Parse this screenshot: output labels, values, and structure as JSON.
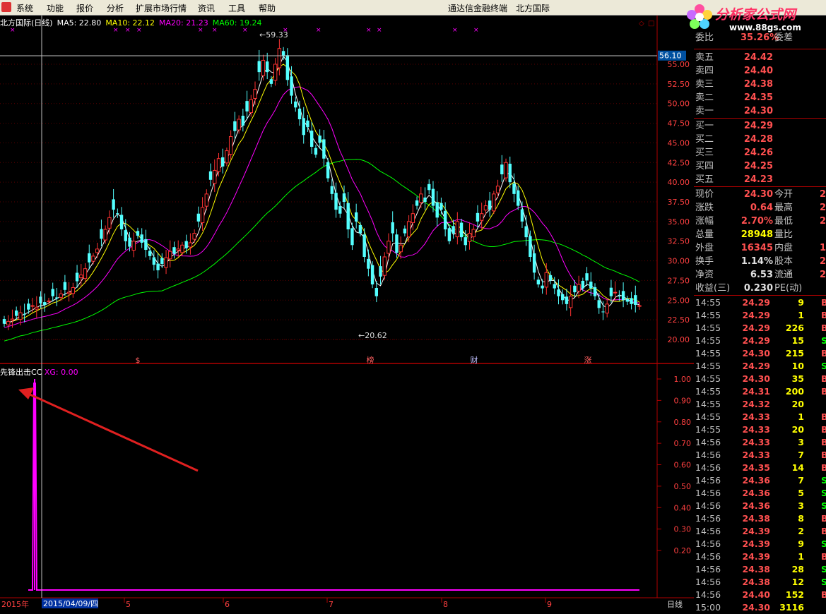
{
  "menu": {
    "items": [
      "系统",
      "功能",
      "报价",
      "分析",
      "扩展市场行情",
      "资讯",
      "工具",
      "帮助"
    ],
    "center_title": "通达信金融终端",
    "stock_title": "北方国际"
  },
  "logo": {
    "text": "分析家公式网",
    "url": "www.88gs.com"
  },
  "legend": {
    "title": "北方国际(日线)",
    "ma5": "MA5: 22.80",
    "ma10": "MA10: 22.12",
    "ma20": "MA20: 21.23",
    "ma60": "MA60: 19.24"
  },
  "indicator_legend": {
    "name": "先锋出击CC",
    "xg": "XG: 0.00"
  },
  "price_axis": [
    "55.00",
    "52.50",
    "50.00",
    "47.50",
    "45.00",
    "42.50",
    "40.00",
    "37.50",
    "35.00",
    "32.50",
    "30.00",
    "27.50",
    "25.00",
    "22.50",
    "20.00"
  ],
  "price_marker": "56.10",
  "indicator_axis": [
    "1.00",
    "0.90",
    "0.80",
    "0.70",
    "0.60",
    "0.50",
    "0.40",
    "0.30",
    "0.20"
  ],
  "chart_annotations": {
    "high": "59.33",
    "low": "20.62"
  },
  "event_marks": [
    "$",
    "榜",
    "财",
    "涨"
  ],
  "time_axis": {
    "year": "2015年",
    "cursor_date": "2015/04/09/四",
    "months": [
      "5",
      "6",
      "7",
      "8",
      "9"
    ],
    "period": "日线"
  },
  "colors": {
    "ma5": "#ffffff",
    "ma10": "#ffff00",
    "ma20": "#ff00ff",
    "ma60": "#00ff00",
    "up": "#ff3232",
    "down": "#54ffff",
    "indicator": "#ff00ff",
    "frame": "#b00000"
  },
  "order_book": {
    "ratio": {
      "label": "委比",
      "value": "35.26%",
      "label2": "委差"
    },
    "asks": [
      {
        "label": "卖五",
        "price": "24.42"
      },
      {
        "label": "卖四",
        "price": "24.40"
      },
      {
        "label": "卖三",
        "price": "24.38"
      },
      {
        "label": "卖二",
        "price": "24.35"
      },
      {
        "label": "卖一",
        "price": "24.30"
      }
    ],
    "bids": [
      {
        "label": "买一",
        "price": "24.29"
      },
      {
        "label": "买二",
        "price": "24.28"
      },
      {
        "label": "买三",
        "price": "24.26"
      },
      {
        "label": "买四",
        "price": "24.25"
      },
      {
        "label": "买五",
        "price": "24.23"
      }
    ]
  },
  "quote": [
    {
      "l1": "现价",
      "v1": "24.30",
      "l2": "今开",
      "v2": "2"
    },
    {
      "l1": "涨跌",
      "v1": "0.64",
      "l2": "最高",
      "v2": "2"
    },
    {
      "l1": "涨幅",
      "v1": "2.70%",
      "l2": "最低",
      "v2": "2"
    },
    {
      "l1": "总量",
      "v1": "28948",
      "l2": "量比",
      "v2": ""
    },
    {
      "l1": "外盘",
      "v1": "16345",
      "l2": "内盘",
      "v2": "1"
    },
    {
      "l1": "换手",
      "v1": "1.14%",
      "l2": "股本",
      "v2": "2"
    },
    {
      "l1": "净资",
      "v1": "6.53",
      "l2": "流通",
      "v2": "2"
    },
    {
      "l1": "收益(三)",
      "v1": "0.230",
      "l2": "PE(动)",
      "v2": ""
    }
  ],
  "ticks": [
    {
      "t": "14:55",
      "p": "24.29",
      "v": "9",
      "bs": "B"
    },
    {
      "t": "14:55",
      "p": "24.29",
      "v": "1",
      "bs": "B"
    },
    {
      "t": "14:55",
      "p": "24.29",
      "v": "226",
      "bs": "B"
    },
    {
      "t": "14:55",
      "p": "24.29",
      "v": "15",
      "bs": "S"
    },
    {
      "t": "14:55",
      "p": "24.30",
      "v": "215",
      "bs": "B"
    },
    {
      "t": "14:55",
      "p": "24.29",
      "v": "10",
      "bs": "S"
    },
    {
      "t": "14:55",
      "p": "24.30",
      "v": "35",
      "bs": "B"
    },
    {
      "t": "14:55",
      "p": "24.31",
      "v": "200",
      "bs": "B"
    },
    {
      "t": "14:55",
      "p": "24.32",
      "v": "20",
      "bs": ""
    },
    {
      "t": "14:55",
      "p": "24.33",
      "v": "1",
      "bs": "B"
    },
    {
      "t": "14:55",
      "p": "24.33",
      "v": "20",
      "bs": "B"
    },
    {
      "t": "14:56",
      "p": "24.33",
      "v": "3",
      "bs": "B"
    },
    {
      "t": "14:56",
      "p": "24.33",
      "v": "7",
      "bs": "B"
    },
    {
      "t": "14:56",
      "p": "24.35",
      "v": "14",
      "bs": "B"
    },
    {
      "t": "14:56",
      "p": "24.36",
      "v": "7",
      "bs": "S"
    },
    {
      "t": "14:56",
      "p": "24.36",
      "v": "5",
      "bs": "S"
    },
    {
      "t": "14:56",
      "p": "24.36",
      "v": "3",
      "bs": "S"
    },
    {
      "t": "14:56",
      "p": "24.38",
      "v": "8",
      "bs": "B"
    },
    {
      "t": "14:56",
      "p": "24.39",
      "v": "2",
      "bs": "B"
    },
    {
      "t": "14:56",
      "p": "24.39",
      "v": "9",
      "bs": "S"
    },
    {
      "t": "14:56",
      "p": "24.39",
      "v": "1",
      "bs": "B"
    },
    {
      "t": "14:56",
      "p": "24.38",
      "v": "28",
      "bs": "S"
    },
    {
      "t": "14:56",
      "p": "24.38",
      "v": "12",
      "bs": "S"
    },
    {
      "t": "14:56",
      "p": "24.40",
      "v": "152",
      "bs": "B"
    },
    {
      "t": "15:00",
      "p": "24.30",
      "v": "3116",
      "bs": ""
    }
  ],
  "candles_close": [
    22.0,
    22.3,
    22.6,
    23.0,
    23.4,
    23.2,
    23.8,
    24.3,
    24.1,
    24.6,
    24.4,
    24.9,
    25.5,
    25.2,
    25.8,
    26.3,
    26.0,
    26.6,
    27.4,
    28.2,
    29.0,
    29.8,
    30.6,
    31.5,
    32.8,
    34.0,
    35.5,
    36.5,
    36.0,
    34.0,
    32.5,
    31.8,
    32.5,
    33.2,
    32.3,
    31.4,
    30.6,
    29.5,
    28.8,
    29.6,
    30.4,
    31.2,
    30.9,
    31.5,
    32.0,
    31.6,
    32.3,
    33.5,
    35.0,
    36.8,
    38.5,
    40.3,
    41.5,
    43.0,
    42.0,
    44.0,
    45.8,
    46.5,
    48.0,
    47.2,
    49.0,
    50.5,
    51.8,
    54.0,
    55.5,
    54.0,
    52.5,
    55.0,
    57.0,
    56.0,
    53.0,
    51.0,
    49.5,
    48.0,
    46.0,
    47.0,
    44.5,
    43.5,
    45.0,
    43.0,
    40.5,
    38.5,
    36.5,
    36.0,
    37.5,
    34.0,
    32.0,
    35.0,
    33.5,
    30.5,
    29.0,
    27.0,
    25.5,
    28.0,
    30.5,
    32.5,
    33.5,
    31.0,
    32.0,
    33.5,
    35.0,
    36.0,
    37.0,
    38.5,
    37.5,
    39.0,
    37.0,
    35.5,
    36.5,
    34.0,
    32.5,
    33.5,
    35.0,
    33.0,
    32.0,
    33.5,
    34.0,
    35.0,
    36.0,
    37.0,
    36.5,
    38.5,
    39.5,
    41.0,
    42.5,
    40.0,
    38.5,
    37.0,
    35.0,
    33.0,
    30.5,
    28.5,
    27.0,
    26.5,
    28.5,
    27.5,
    26.5,
    25.5,
    25.0,
    24.5,
    25.5,
    26.0,
    27.0,
    26.5,
    27.5,
    26.5,
    25.5,
    24.0,
    23.5,
    24.5,
    25.5,
    26.0,
    25.5,
    25.0,
    24.8,
    24.5,
    24.4,
    24.3
  ],
  "indicator_spike_index": 5
}
